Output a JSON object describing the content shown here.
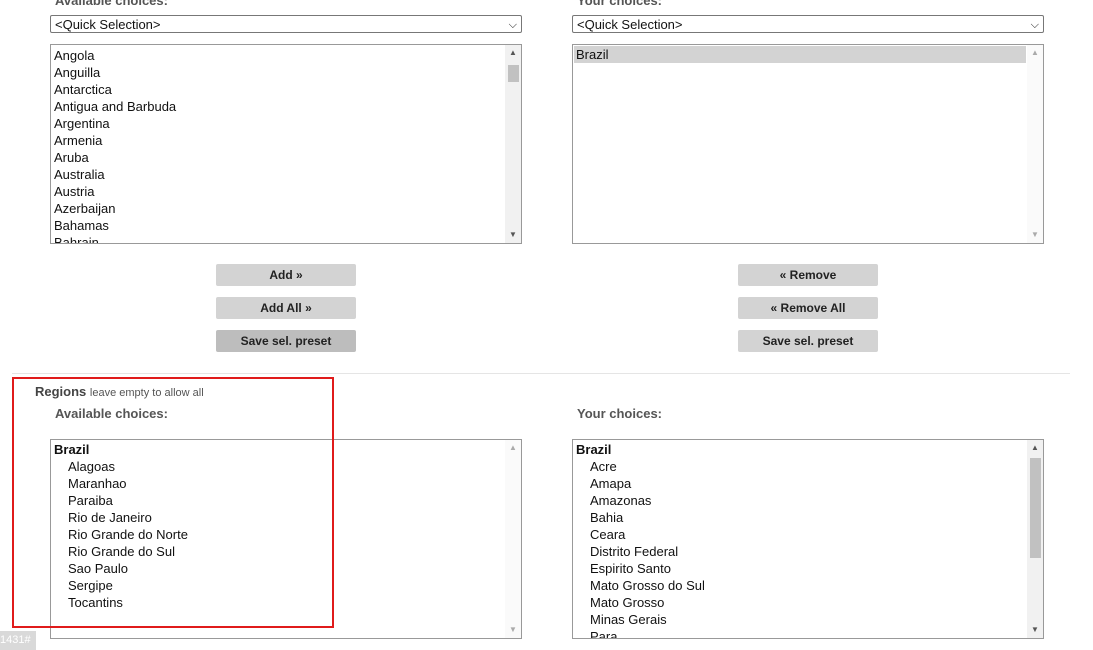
{
  "countries": {
    "available": {
      "label": "Available choices:",
      "quick_selection": "<Quick Selection>",
      "items": [
        "Angola",
        "Anguilla",
        "Antarctica",
        "Antigua and Barbuda",
        "Argentina",
        "Armenia",
        "Aruba",
        "Australia",
        "Austria",
        "Azerbaijan",
        "Bahamas",
        "Bahrain"
      ]
    },
    "chosen": {
      "label": "Your choices:",
      "quick_selection": "<Quick Selection>",
      "items": [
        "Brazil"
      ]
    },
    "buttons": {
      "add": "Add »",
      "add_all": "Add All »",
      "save_preset_left": "Save sel. preset",
      "remove": "« Remove",
      "remove_all": "« Remove All",
      "save_preset_right": "Save sel. preset"
    }
  },
  "regions": {
    "title": "Regions",
    "hint": "leave empty to allow all",
    "available": {
      "label": "Available choices:",
      "group": "Brazil",
      "items": [
        "Alagoas",
        "Maranhao",
        "Paraiba",
        "Rio de Janeiro",
        "Rio Grande do Norte",
        "Rio Grande do Sul",
        "Sao Paulo",
        "Sergipe",
        "Tocantins"
      ]
    },
    "chosen": {
      "label": "Your choices:",
      "group": "Brazil",
      "items": [
        "Acre",
        "Amapa",
        "Amazonas",
        "Bahia",
        "Ceara",
        "Distrito Federal",
        "Espirito Santo",
        "Mato Grosso do Sul",
        "Mato Grosso",
        "Minas Gerais",
        "Para"
      ]
    }
  },
  "corner_tag": "1431#",
  "colors": {
    "highlight": "#e01b1b",
    "selected": "#d3d3d3",
    "button": "#d3d3d3"
  }
}
